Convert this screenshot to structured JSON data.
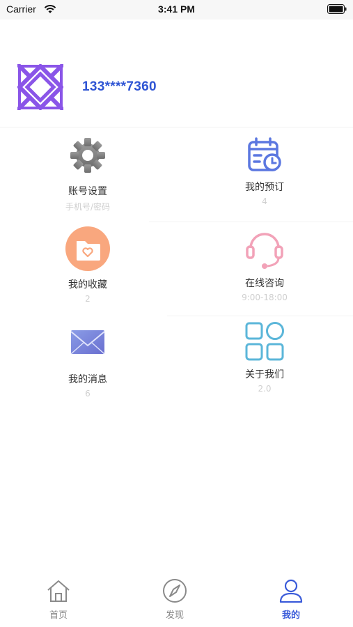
{
  "status_bar": {
    "carrier": "Carrier",
    "time": "3:41 PM"
  },
  "profile": {
    "phone": "133****7360"
  },
  "menu": [
    {
      "label": "账号设置",
      "sub": "手机号/密码",
      "icon": "gear-icon"
    },
    {
      "label": "我的预订",
      "sub": "4",
      "icon": "calendar-icon"
    },
    {
      "label": "我的收藏",
      "sub": "2",
      "icon": "folder-heart-icon"
    },
    {
      "label": "在线咨询",
      "sub": "9:00-18:00",
      "icon": "headset-icon"
    },
    {
      "label": "我的消息",
      "sub": "6",
      "icon": "envelope-icon"
    },
    {
      "label": "关于我们",
      "sub": "2.0",
      "icon": "grid-apps-icon"
    }
  ],
  "tabs": [
    {
      "label": "首页",
      "icon": "home-icon",
      "active": false
    },
    {
      "label": "发现",
      "icon": "compass-icon",
      "active": false
    },
    {
      "label": "我的",
      "icon": "user-icon",
      "active": true
    }
  ],
  "colors": {
    "accent": "#3a5bd9",
    "phone_text": "#2f55d4",
    "logo": "#8a55e8",
    "folder": "#f9a77e",
    "headset": "#f2a2b8",
    "grid": "#5bb6d9"
  }
}
